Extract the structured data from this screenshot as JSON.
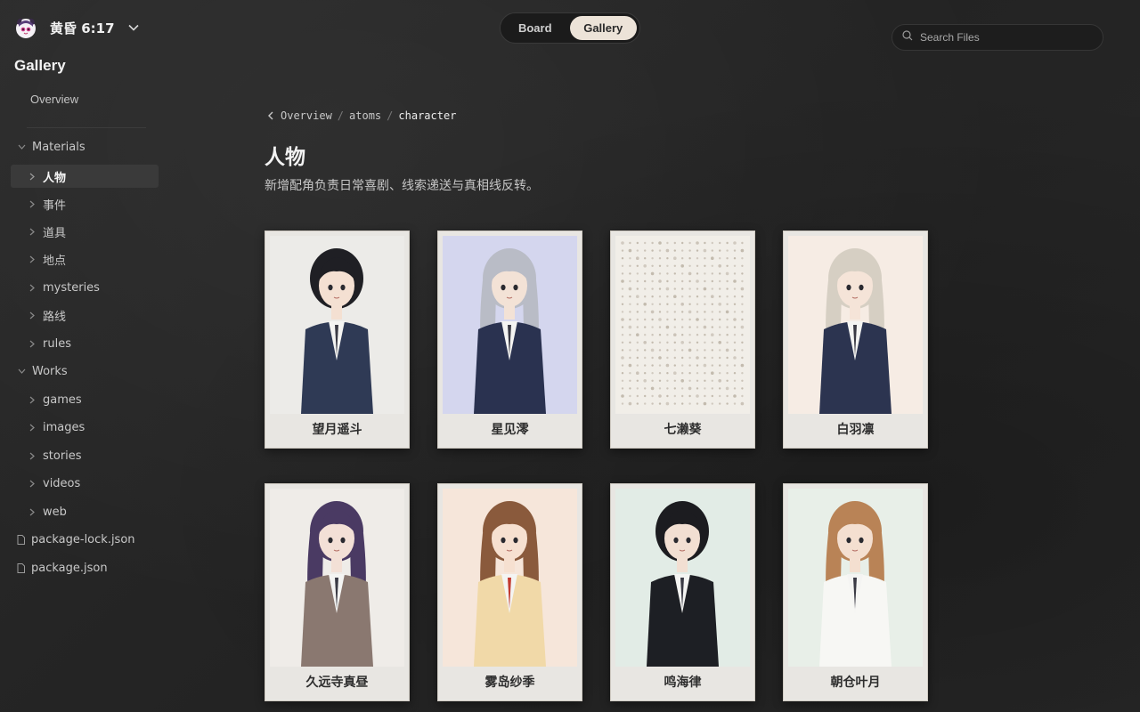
{
  "workspace": {
    "title": "黄昏 6:17"
  },
  "sidebar": {
    "heading": "Gallery",
    "overview": "Overview",
    "materials": {
      "label": "Materials",
      "items": [
        "人物",
        "事件",
        "道具",
        "地点",
        "mysteries",
        "路线",
        "rules"
      ]
    },
    "works": {
      "label": "Works",
      "items": [
        "games",
        "images",
        "stories",
        "videos",
        "web"
      ]
    },
    "files": [
      "package-lock.json",
      "package.json"
    ]
  },
  "view_toggle": {
    "board": "Board",
    "gallery": "Gallery",
    "active": "Gallery"
  },
  "search": {
    "placeholder": "Search Files"
  },
  "breadcrumb": {
    "items": [
      "Overview",
      "atoms",
      "character"
    ]
  },
  "page": {
    "title": "人物",
    "description": "新增配角负责日常喜剧、线索递送与真相线反转。"
  },
  "cards": [
    {
      "name": "望月遥斗",
      "palette": {
        "bg": "#ecebe8",
        "hair": "#1f1f24",
        "outfit": "#2f3a55",
        "skin": "#f4e0d2"
      },
      "icon": "character-portrait"
    },
    {
      "name": "星见澪",
      "palette": {
        "bg": "#d4d6ee",
        "hair": "#b9bcc6",
        "outfit": "#2a3250",
        "skin": "#f3e2d6"
      },
      "icon": "character-portrait"
    },
    {
      "name": "七濑葵",
      "palette": {
        "bg": "#f1eee8",
        "dots": "#b7ad9f"
      },
      "icon": "placeholder-dot-pattern"
    },
    {
      "name": "白羽凛",
      "palette": {
        "bg": "#f6ece4",
        "hair": "#d6cfc3",
        "outfit": "#2c3450",
        "skin": "#f5e4d8"
      },
      "icon": "character-portrait"
    },
    {
      "name": "久远寺真昼",
      "palette": {
        "bg": "#efece8",
        "hair": "#4a3a63",
        "outfit": "#8a7870",
        "skin": "#f3e0d6"
      },
      "icon": "character-portrait"
    },
    {
      "name": "雾岛纱季",
      "palette": {
        "bg": "#f6e6da",
        "hair": "#8a5a3c",
        "outfit": "#f1d9a8",
        "skin": "#f6e0d0"
      },
      "icon": "character-portrait"
    },
    {
      "name": "鸣海律",
      "palette": {
        "bg": "#e2ece6",
        "hair": "#1c1c20",
        "outfit": "#1d1f24",
        "skin": "#f2dfd2"
      },
      "icon": "character-portrait"
    },
    {
      "name": "朝仓叶月",
      "palette": {
        "bg": "#e8efe8",
        "hair": "#b98356",
        "outfit": "#f7f7f4",
        "skin": "#f4dfd0"
      },
      "icon": "character-portrait"
    }
  ]
}
